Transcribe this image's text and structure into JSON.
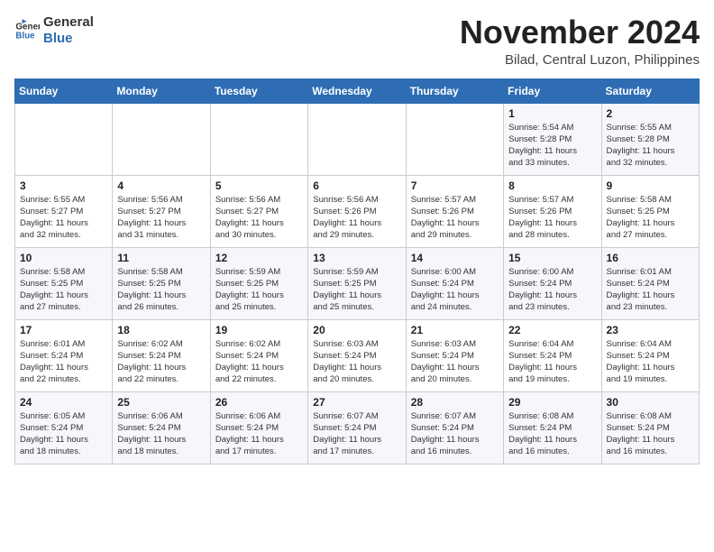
{
  "header": {
    "logo_general": "General",
    "logo_blue": "Blue",
    "month_title": "November 2024",
    "location": "Bilad, Central Luzon, Philippines"
  },
  "days_of_week": [
    "Sunday",
    "Monday",
    "Tuesday",
    "Wednesday",
    "Thursday",
    "Friday",
    "Saturday"
  ],
  "weeks": [
    [
      {
        "num": "",
        "info": ""
      },
      {
        "num": "",
        "info": ""
      },
      {
        "num": "",
        "info": ""
      },
      {
        "num": "",
        "info": ""
      },
      {
        "num": "",
        "info": ""
      },
      {
        "num": "1",
        "info": "Sunrise: 5:54 AM\nSunset: 5:28 PM\nDaylight: 11 hours\nand 33 minutes."
      },
      {
        "num": "2",
        "info": "Sunrise: 5:55 AM\nSunset: 5:28 PM\nDaylight: 11 hours\nand 32 minutes."
      }
    ],
    [
      {
        "num": "3",
        "info": "Sunrise: 5:55 AM\nSunset: 5:27 PM\nDaylight: 11 hours\nand 32 minutes."
      },
      {
        "num": "4",
        "info": "Sunrise: 5:56 AM\nSunset: 5:27 PM\nDaylight: 11 hours\nand 31 minutes."
      },
      {
        "num": "5",
        "info": "Sunrise: 5:56 AM\nSunset: 5:27 PM\nDaylight: 11 hours\nand 30 minutes."
      },
      {
        "num": "6",
        "info": "Sunrise: 5:56 AM\nSunset: 5:26 PM\nDaylight: 11 hours\nand 29 minutes."
      },
      {
        "num": "7",
        "info": "Sunrise: 5:57 AM\nSunset: 5:26 PM\nDaylight: 11 hours\nand 29 minutes."
      },
      {
        "num": "8",
        "info": "Sunrise: 5:57 AM\nSunset: 5:26 PM\nDaylight: 11 hours\nand 28 minutes."
      },
      {
        "num": "9",
        "info": "Sunrise: 5:58 AM\nSunset: 5:25 PM\nDaylight: 11 hours\nand 27 minutes."
      }
    ],
    [
      {
        "num": "10",
        "info": "Sunrise: 5:58 AM\nSunset: 5:25 PM\nDaylight: 11 hours\nand 27 minutes."
      },
      {
        "num": "11",
        "info": "Sunrise: 5:58 AM\nSunset: 5:25 PM\nDaylight: 11 hours\nand 26 minutes."
      },
      {
        "num": "12",
        "info": "Sunrise: 5:59 AM\nSunset: 5:25 PM\nDaylight: 11 hours\nand 25 minutes."
      },
      {
        "num": "13",
        "info": "Sunrise: 5:59 AM\nSunset: 5:25 PM\nDaylight: 11 hours\nand 25 minutes."
      },
      {
        "num": "14",
        "info": "Sunrise: 6:00 AM\nSunset: 5:24 PM\nDaylight: 11 hours\nand 24 minutes."
      },
      {
        "num": "15",
        "info": "Sunrise: 6:00 AM\nSunset: 5:24 PM\nDaylight: 11 hours\nand 23 minutes."
      },
      {
        "num": "16",
        "info": "Sunrise: 6:01 AM\nSunset: 5:24 PM\nDaylight: 11 hours\nand 23 minutes."
      }
    ],
    [
      {
        "num": "17",
        "info": "Sunrise: 6:01 AM\nSunset: 5:24 PM\nDaylight: 11 hours\nand 22 minutes."
      },
      {
        "num": "18",
        "info": "Sunrise: 6:02 AM\nSunset: 5:24 PM\nDaylight: 11 hours\nand 22 minutes."
      },
      {
        "num": "19",
        "info": "Sunrise: 6:02 AM\nSunset: 5:24 PM\nDaylight: 11 hours\nand 22 minutes."
      },
      {
        "num": "20",
        "info": "Sunrise: 6:03 AM\nSunset: 5:24 PM\nDaylight: 11 hours\nand 20 minutes."
      },
      {
        "num": "21",
        "info": "Sunrise: 6:03 AM\nSunset: 5:24 PM\nDaylight: 11 hours\nand 20 minutes."
      },
      {
        "num": "22",
        "info": "Sunrise: 6:04 AM\nSunset: 5:24 PM\nDaylight: 11 hours\nand 19 minutes."
      },
      {
        "num": "23",
        "info": "Sunrise: 6:04 AM\nSunset: 5:24 PM\nDaylight: 11 hours\nand 19 minutes."
      }
    ],
    [
      {
        "num": "24",
        "info": "Sunrise: 6:05 AM\nSunset: 5:24 PM\nDaylight: 11 hours\nand 18 minutes."
      },
      {
        "num": "25",
        "info": "Sunrise: 6:06 AM\nSunset: 5:24 PM\nDaylight: 11 hours\nand 18 minutes."
      },
      {
        "num": "26",
        "info": "Sunrise: 6:06 AM\nSunset: 5:24 PM\nDaylight: 11 hours\nand 17 minutes."
      },
      {
        "num": "27",
        "info": "Sunrise: 6:07 AM\nSunset: 5:24 PM\nDaylight: 11 hours\nand 17 minutes."
      },
      {
        "num": "28",
        "info": "Sunrise: 6:07 AM\nSunset: 5:24 PM\nDaylight: 11 hours\nand 16 minutes."
      },
      {
        "num": "29",
        "info": "Sunrise: 6:08 AM\nSunset: 5:24 PM\nDaylight: 11 hours\nand 16 minutes."
      },
      {
        "num": "30",
        "info": "Sunrise: 6:08 AM\nSunset: 5:24 PM\nDaylight: 11 hours\nand 16 minutes."
      }
    ]
  ]
}
